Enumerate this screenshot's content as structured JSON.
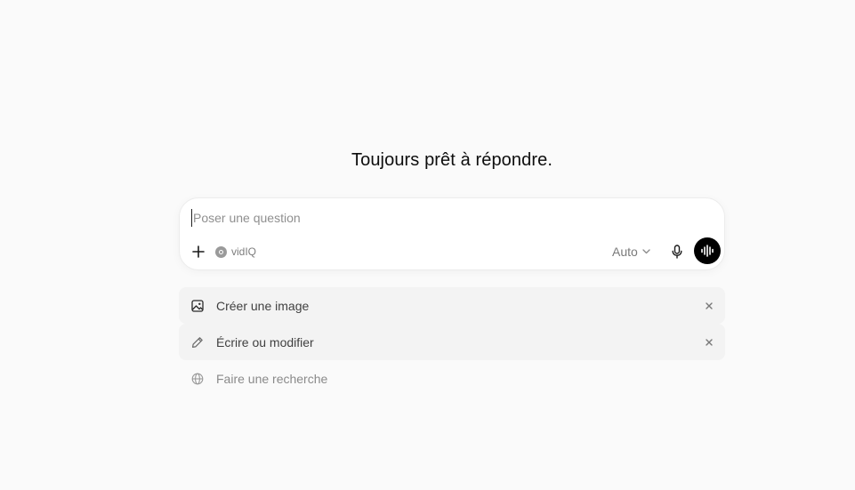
{
  "heading": "Toujours prêt à répondre.",
  "composer": {
    "placeholder": "Poser une question",
    "tool_chip_label": "vidIQ",
    "model_label": "Auto"
  },
  "suggestions": [
    {
      "label": "Créer une image",
      "icon": "image-icon",
      "dismissible": true
    },
    {
      "label": "Écrire ou modifier",
      "icon": "pencil-icon",
      "dismissible": true
    },
    {
      "label": "Faire une recherche",
      "icon": "globe-icon",
      "dismissible": false
    }
  ],
  "colors": {
    "background": "#fafafa",
    "composer_bg": "#ffffff",
    "voice_button": "#000000",
    "suggestion_bg": "#f3f3f3"
  }
}
